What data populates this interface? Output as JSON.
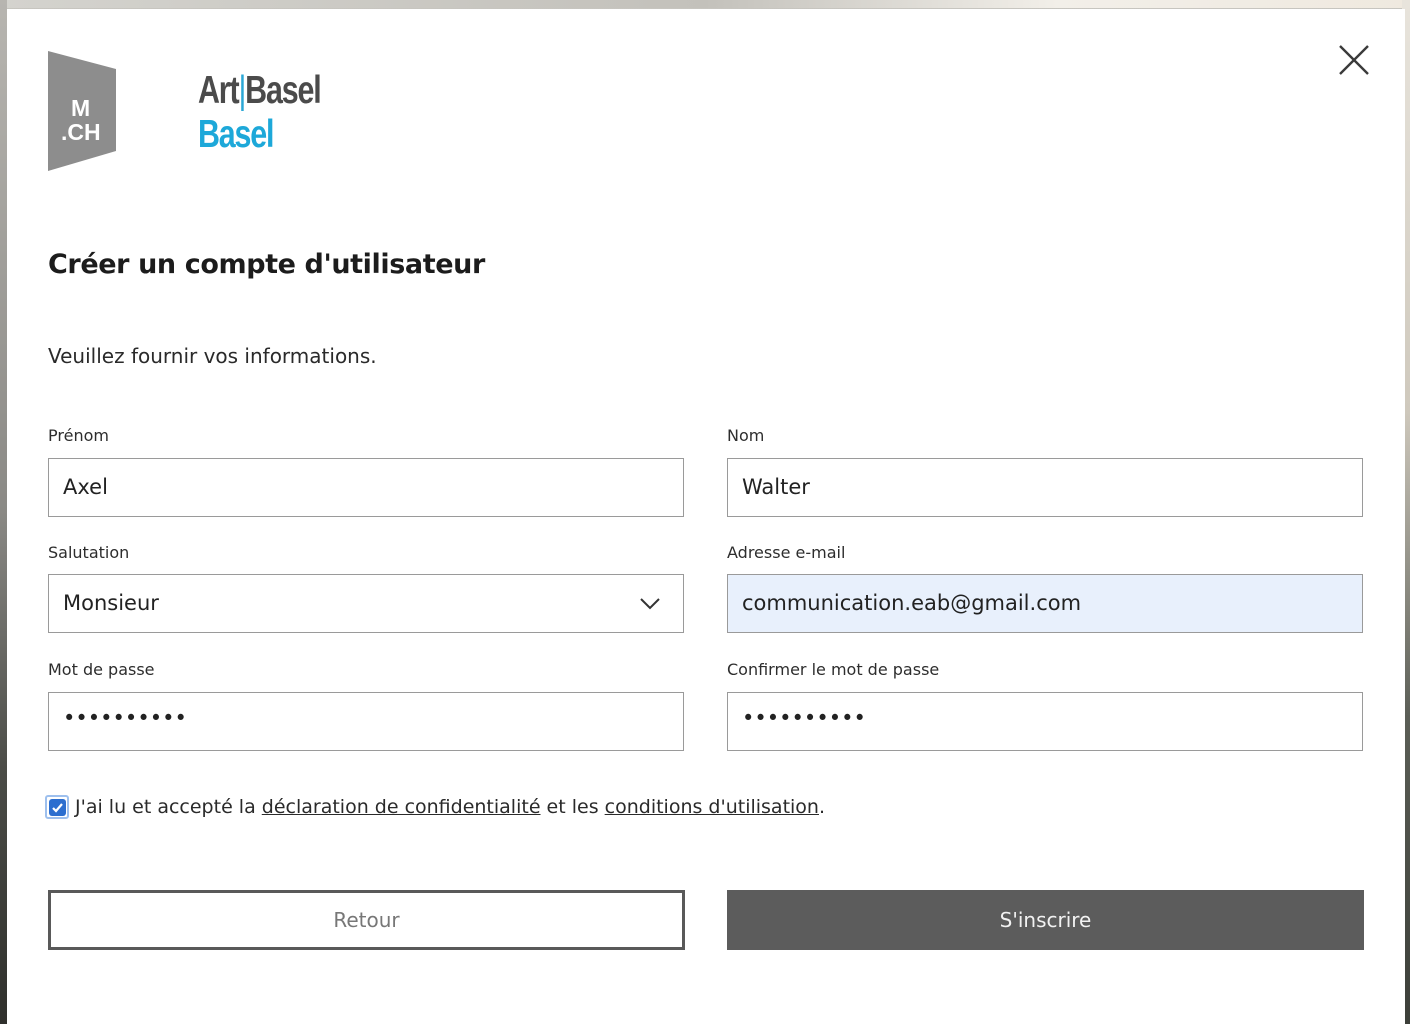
{
  "brand": {
    "mch_logo_line1": "M",
    "mch_logo_line2": ".CH",
    "artbasel_logo_part1": "Art",
    "artbasel_logo_separator": "|",
    "artbasel_logo_part2": "Basel",
    "artbasel_logo_city": "Basel",
    "logo_color_gray": "#4b4b4b",
    "logo_color_blue": "#1da8d9"
  },
  "page": {
    "title": "Créer un compte d'utilisateur",
    "intro": "Veuillez fournir vos informations."
  },
  "form": {
    "first_name": {
      "label": "Prénom",
      "value": "Axel"
    },
    "last_name": {
      "label": "Nom",
      "value": "Walter"
    },
    "salutation": {
      "label": "Salutation",
      "value": "Monsieur"
    },
    "email": {
      "label": "Adresse e-mail",
      "value": "communication.eab@gmail.com"
    },
    "password": {
      "label": "Mot de passe",
      "value": "••••••••••"
    },
    "confirm_password": {
      "label": "Confirmer le mot de passe",
      "value": "••••••••••"
    }
  },
  "consent": {
    "checked": true,
    "text_before": "J'ai lu et accepté la ",
    "privacy_link": "déclaration de confidentialité",
    "text_middle": " et les ",
    "terms_link": "conditions d'utilisation",
    "text_after": "."
  },
  "actions": {
    "back_label": "Retour",
    "submit_label": "S'inscrire"
  },
  "icons": {
    "close": "close-icon",
    "dropdown": "chevron-down-icon",
    "checkbox": "checkmark-icon"
  },
  "colors": {
    "accent_blue": "#1da8d9",
    "checkbox_blue": "#2c6ecf",
    "submit_bg": "#5c5c5c",
    "autofill_bg": "#e8f0fc"
  }
}
